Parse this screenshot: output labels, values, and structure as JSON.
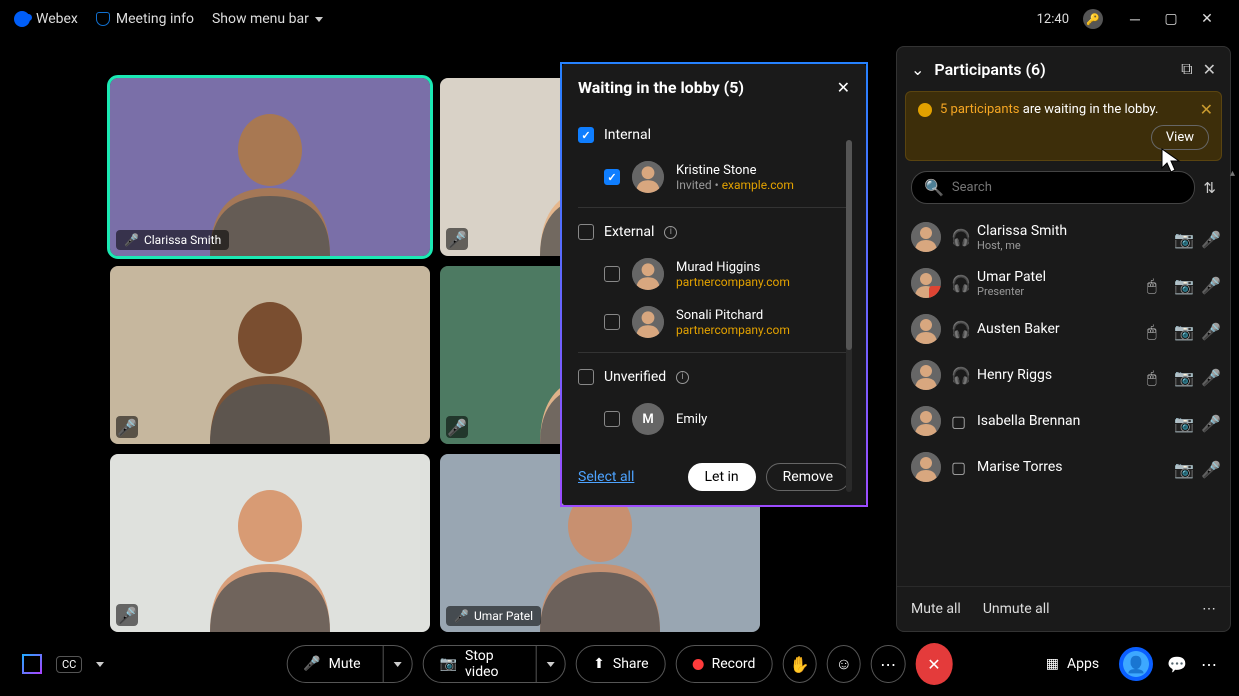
{
  "topbar": {
    "app_name": "Webex",
    "meeting_info": "Meeting info",
    "show_menu": "Show menu bar",
    "clock": "12:40",
    "layout_btn": "Layout"
  },
  "video_tiles": [
    {
      "name": "Clarissa Smith",
      "mic": "green",
      "active": true,
      "bg": "#7a6fa8",
      "skin": "#a87852"
    },
    {
      "name": "",
      "mic": "red",
      "active": false,
      "bg": "#d9d2c7",
      "skin": "#e6b58a"
    },
    {
      "name": "",
      "mic": "red",
      "active": false,
      "bg": "#c6b79e",
      "skin": "#7a4e30"
    },
    {
      "name": "",
      "mic": "red",
      "active": false,
      "bg": "#4d7a62",
      "skin": "#e7b68c"
    },
    {
      "name": "",
      "mic": "red",
      "active": false,
      "bg": "#dfe1dd",
      "skin": "#d89b74"
    },
    {
      "name": "Umar Patel",
      "mic": "green",
      "active": false,
      "bg": "#99a6b2",
      "skin": "#c89070"
    }
  ],
  "lobby": {
    "title": "Waiting in the lobby (5)",
    "groups": [
      {
        "label": "Internal",
        "checked": true,
        "info": false,
        "entries": [
          {
            "checked": true,
            "name": "Kristine Stone",
            "sub_prefix": "Invited",
            "domain": "example.com",
            "initial": ""
          }
        ]
      },
      {
        "label": "External",
        "checked": false,
        "info": true,
        "entries": [
          {
            "checked": false,
            "name": "Murad Higgins",
            "sub_prefix": "",
            "domain": "partnercompany.com",
            "initial": ""
          },
          {
            "checked": false,
            "name": "Sonali Pitchard",
            "sub_prefix": "",
            "domain": "partnercompany.com",
            "initial": ""
          }
        ]
      },
      {
        "label": "Unverified",
        "checked": false,
        "info": true,
        "entries": [
          {
            "checked": false,
            "name": "Emily",
            "sub_prefix": "",
            "domain": "",
            "initial": "M"
          }
        ]
      }
    ],
    "select_all": "Select all",
    "let_in": "Let in",
    "remove": "Remove"
  },
  "participants_panel": {
    "title": "Participants (6)",
    "alert_count": "5 participants",
    "alert_rest": " are waiting in the lobby.",
    "view": "View",
    "search_placeholder": "Search",
    "list": [
      {
        "name": "Clarissa Smith",
        "role": "Host, me",
        "headset": true,
        "raised": false,
        "mouse": false,
        "cam": true,
        "mic": "green"
      },
      {
        "name": "Umar Patel",
        "role": "Presenter",
        "headset": true,
        "raised": true,
        "mouse": true,
        "cam": true,
        "mic": "green"
      },
      {
        "name": "Austen Baker",
        "role": "",
        "headset": true,
        "raised": false,
        "mouse": true,
        "cam": true,
        "mic": "red"
      },
      {
        "name": "Henry Riggs",
        "role": "",
        "headset": true,
        "raised": false,
        "mouse": true,
        "cam": true,
        "mic": "red"
      },
      {
        "name": "Isabella Brennan",
        "role": "",
        "headset": false,
        "raised": false,
        "mouse": false,
        "cam": true,
        "mic": "red",
        "device": true
      },
      {
        "name": "Marise Torres",
        "role": "",
        "headset": false,
        "raised": false,
        "mouse": false,
        "cam": true,
        "mic": "red",
        "device": true
      }
    ],
    "mute_all": "Mute all",
    "unmute_all": "Unmute all"
  },
  "bottombar": {
    "mute": "Mute",
    "stop_video": "Stop video",
    "share": "Share",
    "record": "Record",
    "apps": "Apps"
  }
}
